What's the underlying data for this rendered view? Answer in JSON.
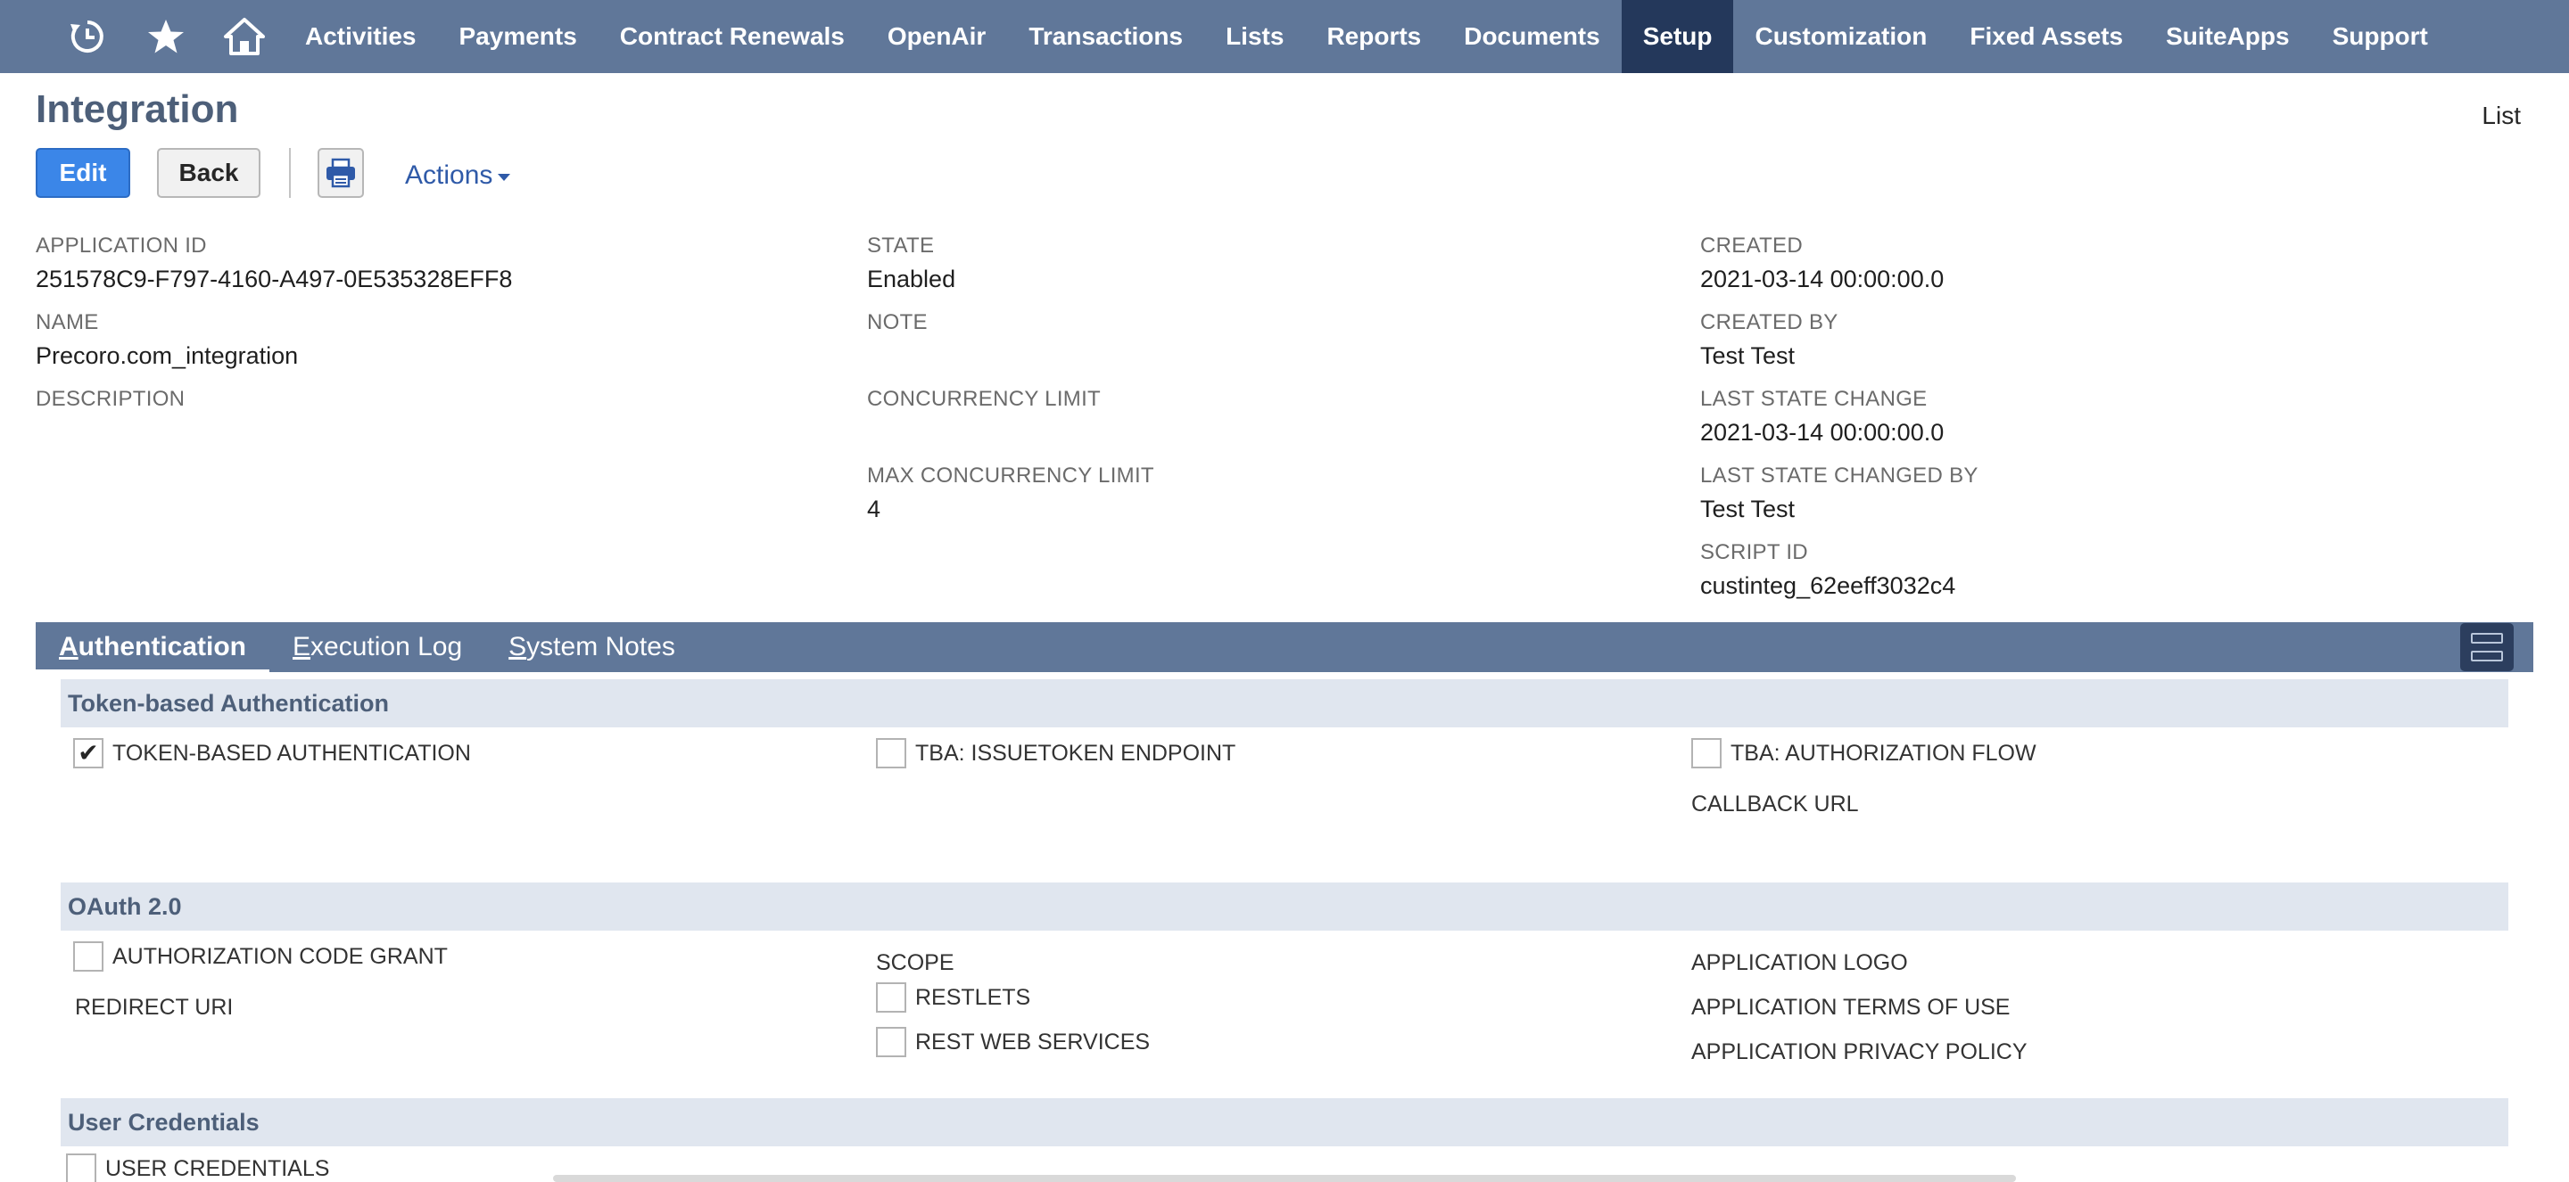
{
  "nav": {
    "icons": [
      "recent-records-icon",
      "favorites-star-icon",
      "home-icon"
    ],
    "items": [
      {
        "label": "Activities",
        "active": false
      },
      {
        "label": "Payments",
        "active": false
      },
      {
        "label": "Contract Renewals",
        "active": false
      },
      {
        "label": "OpenAir",
        "active": false
      },
      {
        "label": "Transactions",
        "active": false
      },
      {
        "label": "Lists",
        "active": false
      },
      {
        "label": "Reports",
        "active": false
      },
      {
        "label": "Documents",
        "active": false
      },
      {
        "label": "Setup",
        "active": true
      },
      {
        "label": "Customization",
        "active": false
      },
      {
        "label": "Fixed Assets",
        "active": false
      },
      {
        "label": "SuiteApps",
        "active": false
      },
      {
        "label": "Support",
        "active": false
      }
    ],
    "active_color": "#24385b",
    "bar_color": "#607799"
  },
  "page": {
    "title": "Integration",
    "list_link": "List"
  },
  "toolbar": {
    "edit_label": "Edit",
    "back_label": "Back",
    "print_icon": "print-icon",
    "actions_label": "Actions"
  },
  "fields": {
    "application_id": {
      "label": "APPLICATION ID",
      "value": "251578C9-F797-4160-A497-0E535328EFF8"
    },
    "name": {
      "label": "NAME",
      "value": "Precoro.com_integration"
    },
    "description": {
      "label": "DESCRIPTION",
      "value": ""
    },
    "state": {
      "label": "STATE",
      "value": "Enabled"
    },
    "note": {
      "label": "NOTE",
      "value": ""
    },
    "concurrency_limit": {
      "label": "CONCURRENCY LIMIT",
      "value": ""
    },
    "max_concurrency_limit": {
      "label": "MAX CONCURRENCY LIMIT",
      "value": "4"
    },
    "created": {
      "label": "CREATED",
      "value": "2021-03-14 00:00:00.0"
    },
    "created_by": {
      "label": "CREATED BY",
      "value": "Test Test"
    },
    "last_state_change": {
      "label": "LAST STATE CHANGE",
      "value": "2021-03-14 00:00:00.0"
    },
    "last_state_changed_by": {
      "label": "LAST STATE CHANGED BY",
      "value": "Test Test"
    },
    "script_id": {
      "label": "SCRIPT ID",
      "value": "custinteg_62eeff3032c4"
    }
  },
  "subtabs": {
    "authentication": {
      "first": "A",
      "rest": "uthentication"
    },
    "execution_log": {
      "first": "E",
      "rest": "xecution Log"
    },
    "system_notes": {
      "first": "S",
      "rest": "ystem Notes"
    }
  },
  "sections": {
    "tba": {
      "title": "Token-based Authentication",
      "token_based_auth": {
        "label": "TOKEN-BASED AUTHENTICATION",
        "checked": true
      },
      "issuetoken_endpoint": {
        "label": "TBA: ISSUETOKEN ENDPOINT",
        "checked": false
      },
      "authorization_flow": {
        "label": "TBA: AUTHORIZATION FLOW",
        "checked": false
      },
      "callback_url": "CALLBACK URL"
    },
    "oauth": {
      "title": "OAuth 2.0",
      "authorization_code_grant": {
        "label": "AUTHORIZATION CODE GRANT",
        "checked": false
      },
      "redirect_uri": "REDIRECT URI",
      "scope": "SCOPE",
      "restlets": {
        "label": "RESTLETS",
        "checked": false
      },
      "rest_web_services": {
        "label": "REST WEB SERVICES",
        "checked": false
      },
      "application_logo": "APPLICATION LOGO",
      "application_terms": "APPLICATION TERMS OF USE",
      "application_privacy": "APPLICATION PRIVACY POLICY"
    },
    "user_credentials": {
      "title": "User Credentials",
      "user_credentials_cb": {
        "label": "USER CREDENTIALS",
        "checked": false
      }
    }
  }
}
